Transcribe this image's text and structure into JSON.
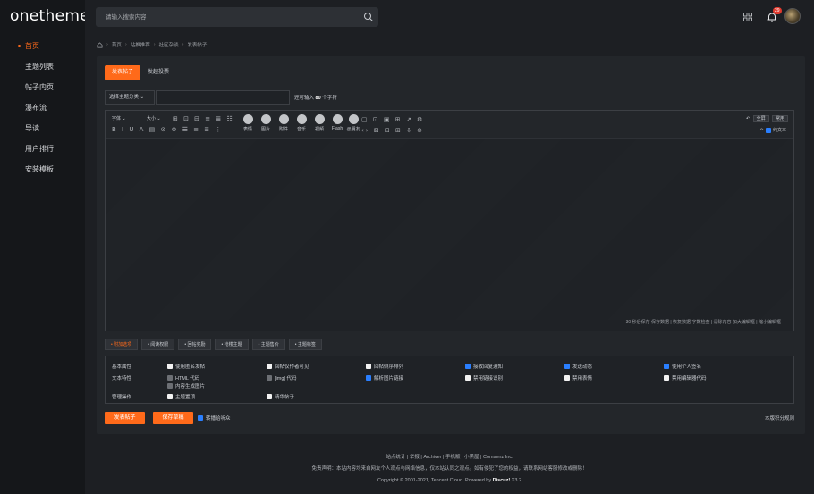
{
  "logo": "onetheme",
  "sidebar": {
    "items": [
      {
        "label": "首页"
      },
      {
        "label": "主题列表"
      },
      {
        "label": "帖子内页"
      },
      {
        "label": "瀑布流"
      },
      {
        "label": "导读"
      },
      {
        "label": "用户排行"
      },
      {
        "label": "安装模板"
      }
    ]
  },
  "header": {
    "search_placeholder": "请输入搜索内容",
    "notification_count": "29"
  },
  "breadcrumb": [
    "首页",
    "站推推荐",
    "社区杂谈",
    "发表帖子"
  ],
  "tabs": {
    "post": "发表帖子",
    "vote": "发起投票"
  },
  "form": {
    "topic_select": "选择主题分类",
    "char_hint_prefix": "还可输入",
    "char_hint_count": "80",
    "char_hint_suffix": "个字符"
  },
  "toolbar": {
    "font": "字体",
    "size": "大小",
    "big_buttons": [
      "表情",
      "图片",
      "附件",
      "音乐",
      "视频",
      "Flash",
      "@朋友"
    ],
    "fullscreen": "全屏",
    "common": "常用",
    "plain_text": "纯文本",
    "row1": "B I U A ▤ ⊘ ⊗ ☰ ≡ ≣ ⋮",
    "row2": "⊞ ⊡ ⊟ ≡ ≣ ☷"
  },
  "editor_status": "30 秒后保存 保存数据 | 恢复数据 字数检查 | 清除内容 加大编辑框 | 缩小编辑框",
  "option_tabs": [
    "附加选项",
    "阅读权限",
    "回帖奖励",
    "抢楼主题",
    "主题售价",
    "主题标签"
  ],
  "options": {
    "basic": {
      "label": "基本属性",
      "items": [
        {
          "text": "使用匿名发帖",
          "checked": false
        },
        {
          "text": "回帖仅作者可见",
          "checked": false
        },
        {
          "text": "回帖倒序排列",
          "checked": false
        },
        {
          "text": "接收回复通知",
          "checked": true
        },
        {
          "text": "发送动态",
          "checked": true
        },
        {
          "text": "使用个人签名",
          "checked": true
        }
      ]
    },
    "text": {
      "label": "文本特性",
      "items": [
        {
          "text": "HTML 代码",
          "checked": false
        },
        {
          "text": "[img] 代码",
          "checked": false
        },
        {
          "text": "解析图片链接",
          "checked": true
        },
        {
          "text": "禁用链接识别",
          "checked": false
        },
        {
          "text": "禁用表情",
          "checked": false
        },
        {
          "text": "禁用编辑器代码",
          "checked": false
        }
      ],
      "extra": "内容生成图片"
    },
    "manage": {
      "label": "管理操作",
      "items": [
        {
          "text": "主题置顶",
          "checked": false
        },
        {
          "text": "精华帖子",
          "checked": false
        }
      ]
    }
  },
  "actions": {
    "post": "发表帖子",
    "save_draft": "保存草稿",
    "anon": "转播给听众",
    "rules": "本版积分规则"
  },
  "footer": {
    "links": "站点统计 | 举报 | Archiver | 手机版 | 小黑屋 | Comsenz Inc.",
    "disclaimer": "免责声明：本站内容均来自网友个人观点与网络信息，仅本站认同之观点。如有侵犯了您的权益，请联系网站客服修改或删除！",
    "copyright": "Copyright © 2001-2021, Tencent Cloud. Powered by ",
    "brand": "Discuz!",
    "version": " X3.2"
  }
}
